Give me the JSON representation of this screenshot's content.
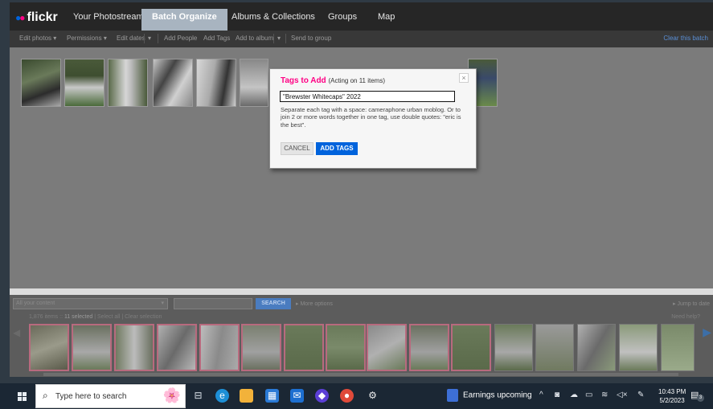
{
  "nav": {
    "logo": "flickr",
    "tabs": [
      "Your Photostream",
      "Batch Organize",
      "Albums & Collections",
      "Groups",
      "Map"
    ],
    "active_tab": "Batch Organize"
  },
  "toolbar": {
    "edit_photos": "Edit photos",
    "permissions": "Permissions",
    "edit_dates": "Edit dates",
    "add_people": "Add People",
    "add_tags": "Add Tags",
    "add_to_album": "Add to album",
    "send_to_group": "Send to group",
    "clear_batch": "Clear this batch",
    "dropdown_glyph": "▾"
  },
  "modal": {
    "title": "Tags to Add",
    "acting": "(Acting on 11 items)",
    "close_glyph": "×",
    "input_value": "\"Brewster Whitecaps\" 2022",
    "help_text": "Separate each tag with a space: cameraphone urban moblog. Or to join 2 or more words together in one tag, use double quotes: \"eric is the best\".",
    "cancel_label": "CANCEL",
    "add_label": "ADD TAGS"
  },
  "bottom": {
    "content_select": "All your content",
    "search_label": "SEARCH",
    "more_options": "▸ More options",
    "jump_to_date": "▸ Jump to date",
    "items_count": "1,876 items",
    "items_selected": "11 selected",
    "select_all": "Select all",
    "clear_selection": "Clear selection",
    "need_help": "Need help?"
  },
  "taskbar": {
    "search_placeholder": "Type here to search",
    "news_label": "Earnings upcoming",
    "time": "10:43 PM",
    "date": "5/2/2023",
    "notification_count": "3"
  },
  "colors": {
    "flickr_pink": "#ff0084",
    "flickr_blue": "#0063dc",
    "selected_border": "#b86a7e"
  },
  "icons": [
    "windows-start-icon",
    "search-icon",
    "task-view-icon",
    "edge-icon",
    "file-explorer-icon",
    "store-icon",
    "mail-icon",
    "copilot-icon",
    "chrome-icon",
    "settings-icon",
    "news-icon",
    "chevron-up-icon",
    "camera-icon",
    "cloud-icon",
    "battery-icon",
    "wifi-icon",
    "volume-icon",
    "pen-icon",
    "notification-icon"
  ]
}
